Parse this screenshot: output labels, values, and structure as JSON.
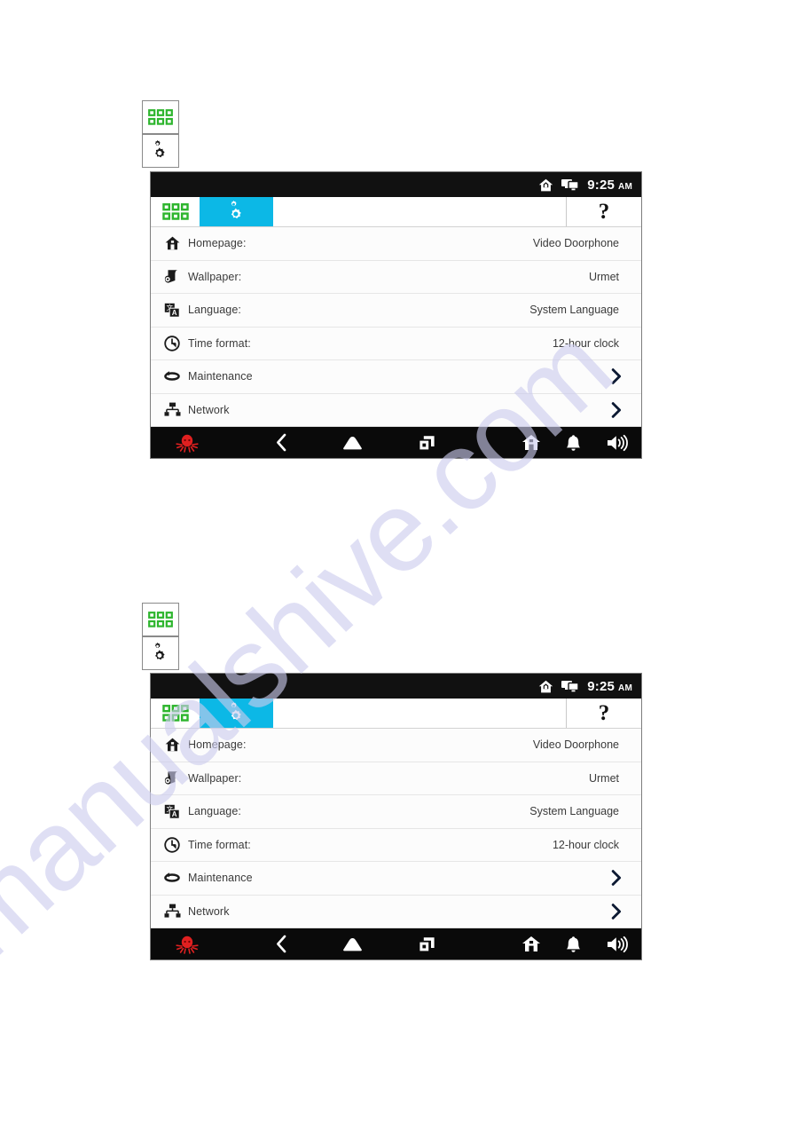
{
  "page": {
    "watermark": "manualshive.com"
  },
  "colors": {
    "active_tab": "#0cb8e6",
    "grid_icon_green": "#2db52d",
    "logo_red": "#e02020",
    "statusbar_bg": "#111111",
    "navbar_bg": "#0a0a0a"
  },
  "standalone_icons": [
    {
      "name": "apps-grid-icon",
      "label": "Applications"
    },
    {
      "name": "settings-gear-icon",
      "label": "Settings"
    }
  ],
  "screen": {
    "statusbar": {
      "home_icon": "home-icon",
      "screens_icon": "screens-icon",
      "time": "9:25",
      "meridiem": "AM"
    },
    "tabs": [
      {
        "name": "tab-applications",
        "icon": "apps-grid-icon",
        "active": false
      },
      {
        "name": "tab-settings",
        "icon": "settings-gear-icon",
        "active": true
      }
    ],
    "help_button": {
      "label": "?",
      "name": "help-button"
    },
    "settings_rows": [
      {
        "icon": "home-icon",
        "label": "Homepage:",
        "value": "Video Doorphone",
        "chevron": false
      },
      {
        "icon": "wallpaper-icon",
        "label": "Wallpaper:",
        "value": "Urmet",
        "chevron": false
      },
      {
        "icon": "language-icon",
        "label": "Language:",
        "value": "System Language",
        "chevron": false
      },
      {
        "icon": "clock-icon",
        "label": "Time format:",
        "value": "12-hour clock",
        "chevron": false
      },
      {
        "icon": "maintenance-icon",
        "label": "Maintenance",
        "value": "",
        "chevron": true
      },
      {
        "icon": "network-icon",
        "label": "Network",
        "value": "",
        "chevron": true
      }
    ],
    "navbar": {
      "logo": "octopus-logo-icon",
      "buttons": [
        {
          "name": "back-button",
          "icon": "chevron-left-icon"
        },
        {
          "name": "home-button",
          "icon": "home-pentagon-icon"
        },
        {
          "name": "recent-apps-button",
          "icon": "recent-apps-icon"
        }
      ],
      "right_buttons": [
        {
          "name": "house-button",
          "icon": "house-icon"
        },
        {
          "name": "bell-button",
          "icon": "bell-icon"
        },
        {
          "name": "volume-button",
          "icon": "speaker-icon"
        }
      ]
    }
  }
}
